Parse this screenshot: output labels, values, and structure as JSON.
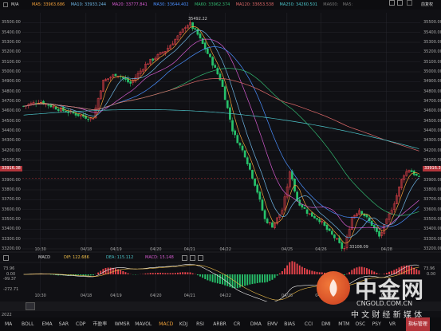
{
  "toolbar": {
    "symbol": "M/A",
    "ma_items": [
      {
        "label": "MA5: 33963.686",
        "color": "#f4a13a"
      },
      {
        "label": "MA10: 33933.244",
        "color": "#6fb7e6"
      },
      {
        "label": "MA20: 33777.841",
        "color": "#d55bd0"
      },
      {
        "label": "MA30: 33644.402",
        "color": "#4a8fff"
      },
      {
        "label": "MA60: 33962.374",
        "color": "#32b870"
      },
      {
        "label": "MA120: 33653.538",
        "color": "#e06a6a"
      },
      {
        "label": "MA250: 34260.501",
        "color": "#4bc3c8"
      },
      {
        "label": "MA600:",
        "color": "#777777"
      },
      {
        "label": "MA5:",
        "color": "#777777"
      }
    ],
    "right_label": "前复权"
  },
  "price_axis": {
    "ticks": [
      "35500.00",
      "35400.00",
      "35300.00",
      "35200.00",
      "35100.00",
      "35000.00",
      "34900.00",
      "34800.00",
      "34700.00",
      "34600.00",
      "34500.00",
      "34400.00",
      "34300.00",
      "34200.00",
      "34100.00",
      "34000.00",
      "33900.00",
      "33800.00",
      "33700.00",
      "33600.00",
      "33500.00",
      "33400.00",
      "33300.00",
      "33200.00"
    ],
    "min": 33200,
    "max": 35600,
    "current": "33916.38",
    "high_label": "35492.22",
    "low_label": "33108.09"
  },
  "time_axis": {
    "labels": [
      {
        "text": "10:30",
        "frac": 0.045
      },
      {
        "text": "04/18",
        "frac": 0.16
      },
      {
        "text": "04/19",
        "frac": 0.235
      },
      {
        "text": "04/20",
        "frac": 0.335
      },
      {
        "text": "04/21",
        "frac": 0.42
      },
      {
        "text": "04/22",
        "frac": 0.51
      },
      {
        "text": "04/25",
        "frac": 0.665
      },
      {
        "text": "04/26",
        "frac": 0.75
      },
      {
        "text": "04/28",
        "frac": 0.915
      }
    ]
  },
  "macd": {
    "title": "MACD",
    "dif_label": "DIF: 122.686",
    "dea_label": "DEA: 115.112",
    "macd_label": "MACD: 15.148",
    "dif_color": "#f4f4f4",
    "dea_color": "#f2c14a",
    "macd_color": "#d55bd0",
    "axis": [
      "73.96",
      "0.00",
      "-99.37",
      "-272.71"
    ]
  },
  "year_label": "2022",
  "bottom_tabs": [
    "MA",
    "BOLL",
    "EMA",
    "SAR",
    "CDP",
    "市盈率",
    "WMSR",
    "MAVOL",
    "MACD",
    "KDJ",
    "RSI",
    "ARBR",
    "CR",
    "DMA",
    "EMV",
    "BIAS",
    "CCI",
    "DMI",
    "MTM",
    "OSC",
    "PSY",
    "VR",
    "指标管理"
  ],
  "active_tab": "MACD",
  "watermark": {
    "brand_cn": "中金网",
    "url": "CNGOLD.COM.CN",
    "tagline": "中 文 财 经 新 媒 体"
  },
  "colors": {
    "up": "#e8434b",
    "down": "#27c26b",
    "bg": "#101014",
    "grid": "#26262c"
  }
}
